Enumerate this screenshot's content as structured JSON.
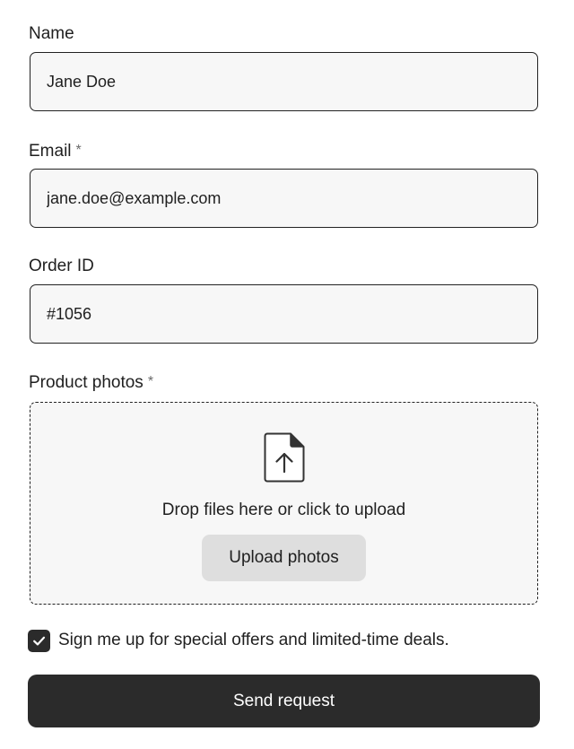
{
  "form": {
    "name": {
      "label": "Name",
      "value": "Jane Doe"
    },
    "email": {
      "label": "Email",
      "required_mark": "*",
      "value": "jane.doe@example.com"
    },
    "order_id": {
      "label": "Order ID",
      "value": "#1056"
    },
    "photos": {
      "label": "Product photos",
      "required_mark": "*",
      "icon": "file-upload-icon",
      "drop_text": "Drop files here or click to upload",
      "button_label": "Upload photos"
    },
    "newsletter": {
      "checked": true,
      "icon": "check-icon",
      "label": "Sign me up for special offers and limited-time deals."
    },
    "submit_label": "Send request"
  },
  "colors": {
    "text": "#1f1f1f",
    "field_background": "#f7f7f7",
    "border": "#222222",
    "primary_button": "#2b2b2b",
    "secondary_button": "#dedede"
  }
}
